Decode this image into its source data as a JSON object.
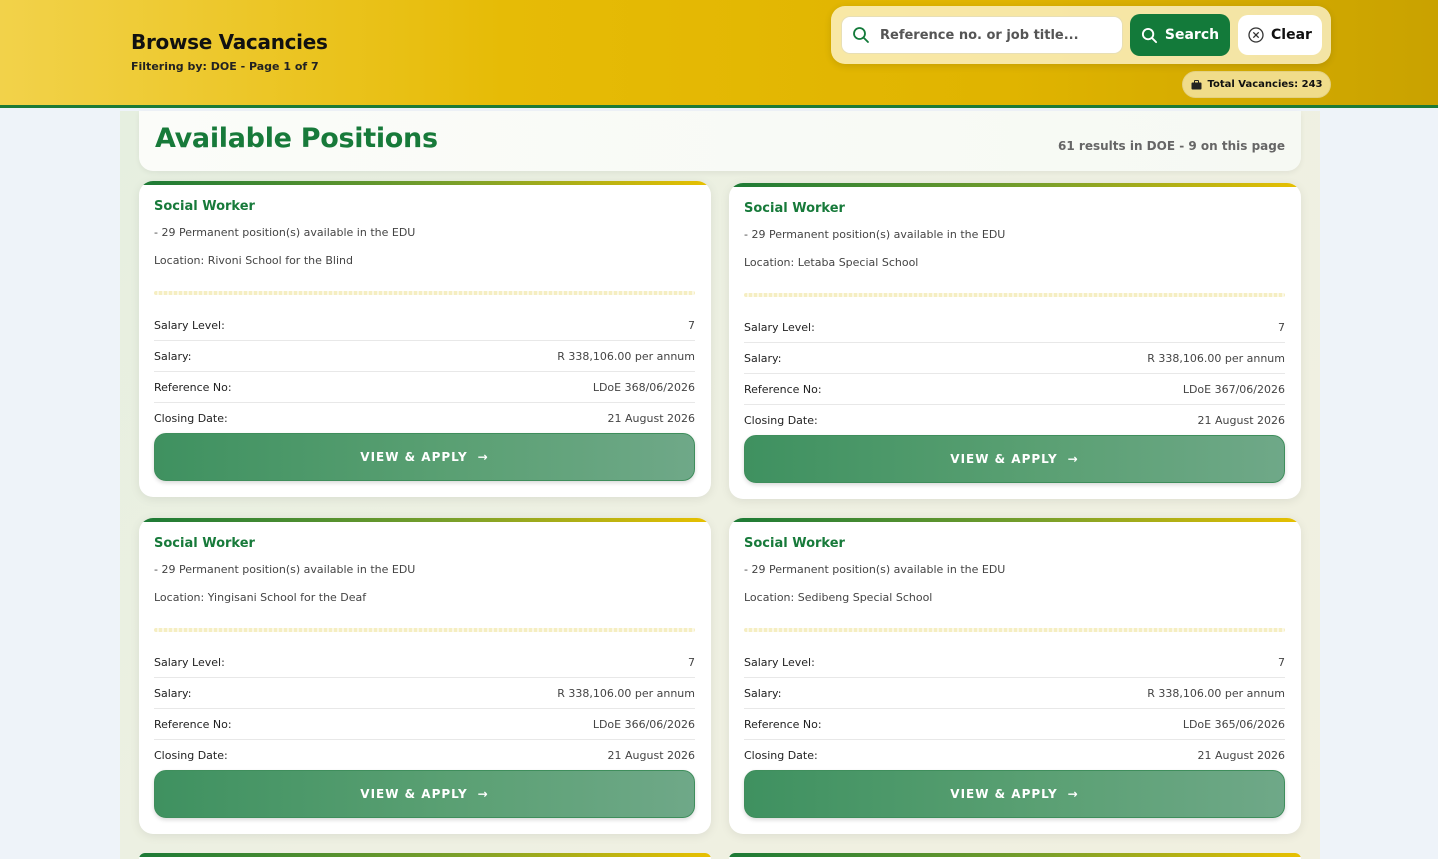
{
  "header": {
    "title": "Browse Vacancies",
    "subtitle": "Filtering by: DOE - Page 1 of 7"
  },
  "search": {
    "placeholder": "Reference no. or job title...",
    "search_label": "Search",
    "clear_label": "Clear",
    "total_label": "Total Vacancies: 243"
  },
  "positions": {
    "title": "Available Positions",
    "count": "61 results in DOE - 9 on this page"
  },
  "labels": {
    "salary_level": "Salary Level:",
    "salary": "Salary:",
    "reference": "Reference No:",
    "closing": "Closing Date:",
    "apply": "VIEW & APPLY"
  },
  "cards": [
    {
      "title": "Social Worker",
      "desc": "- 29 Permanent position(s) available in the EDU",
      "location": "Location: Rivoni School for the Blind",
      "salary_level": "7",
      "salary": "R 338,106.00 per annum",
      "reference": "LDoE 368/06/2026",
      "closing": "21 August 2026"
    },
    {
      "title": "Social Worker",
      "desc": "- 29 Permanent position(s) available in the EDU",
      "location": "Location: Letaba Special School",
      "salary_level": "7",
      "salary": "R 338,106.00 per annum",
      "reference": "LDoE 367/06/2026",
      "closing": "21 August 2026"
    },
    {
      "title": "Social Worker",
      "desc": "- 29 Permanent position(s) available in the EDU",
      "location": "Location: Yingisani School for the Deaf",
      "salary_level": "7",
      "salary": "R 338,106.00 per annum",
      "reference": "LDoE 366/06/2026",
      "closing": "21 August 2026"
    },
    {
      "title": "Social Worker",
      "desc": "- 29 Permanent position(s) available in the EDU",
      "location": "Location: Sedibeng Special School",
      "salary_level": "7",
      "salary": "R 338,106.00 per annum",
      "reference": "LDoE 365/06/2026",
      "closing": "21 August 2026"
    }
  ]
}
